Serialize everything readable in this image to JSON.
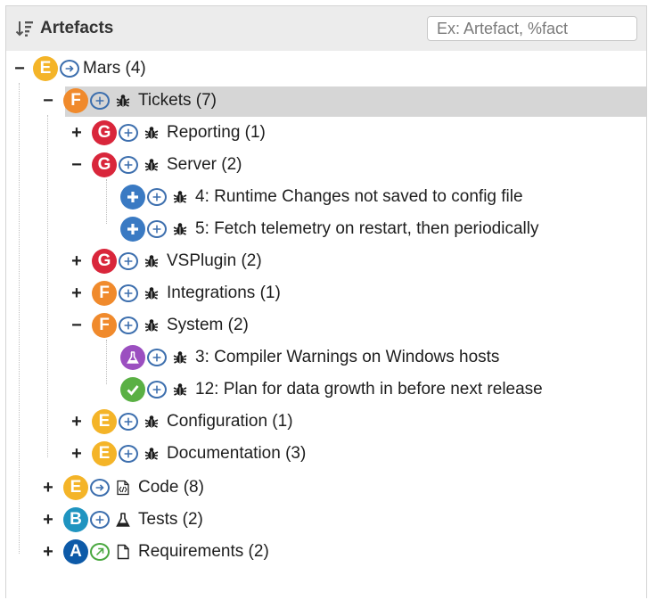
{
  "header": {
    "title": "Artefacts",
    "search_placeholder": "Ex: Artefact, %fact"
  },
  "tree": {
    "mars": {
      "toggle": "−",
      "badge": "E",
      "label": "Mars (4)"
    },
    "tickets": {
      "toggle": "−",
      "badge": "F",
      "label": "Tickets (7)"
    },
    "reporting": {
      "toggle": "+",
      "badge": "G",
      "label": "Reporting (1)"
    },
    "server": {
      "toggle": "−",
      "badge": "G",
      "label": "Server (2)"
    },
    "item4": {
      "label": "4: Runtime Changes not saved to config file"
    },
    "item5": {
      "label": "5: Fetch telemetry on restart, then periodically"
    },
    "vsplugin": {
      "toggle": "+",
      "badge": "G",
      "label": "VSPlugin (2)"
    },
    "integrations": {
      "toggle": "+",
      "badge": "F",
      "label": "Integrations (1)"
    },
    "system": {
      "toggle": "−",
      "badge": "F",
      "label": "System (2)"
    },
    "item3": {
      "label": "3: Compiler Warnings on Windows hosts"
    },
    "item12": {
      "label": "12: Plan for data growth in before next release"
    },
    "configuration": {
      "toggle": "+",
      "badge": "E",
      "label": "Configuration (1)"
    },
    "documentation": {
      "toggle": "+",
      "badge": "E",
      "label": "Documentation (3)"
    },
    "code": {
      "toggle": "+",
      "badge": "E",
      "label": "Code (8)"
    },
    "tests": {
      "toggle": "+",
      "badge": "B",
      "label": "Tests (2)"
    },
    "requirements": {
      "toggle": "+",
      "badge": "A",
      "label": "Requirements (2)"
    }
  },
  "colors": {
    "E": "#f4b428",
    "F": "#f08a2c",
    "G": "#d9263b",
    "B": "#1f94c0",
    "A": "#0d5aa8",
    "selected_row": "#d6d6d6",
    "header_bg": "#ececec"
  },
  "icons": {
    "sort": "sort-descending-icon",
    "arrow_circle": "arrow-right-circle-icon",
    "plus_circle": "plus-circle-icon",
    "bug": "bug-icon",
    "code_file": "code-file-icon",
    "flask": "flask-icon",
    "document": "document-icon",
    "diagonal_arrow": "arrow-up-right-circle-icon",
    "check": "check-icon"
  }
}
